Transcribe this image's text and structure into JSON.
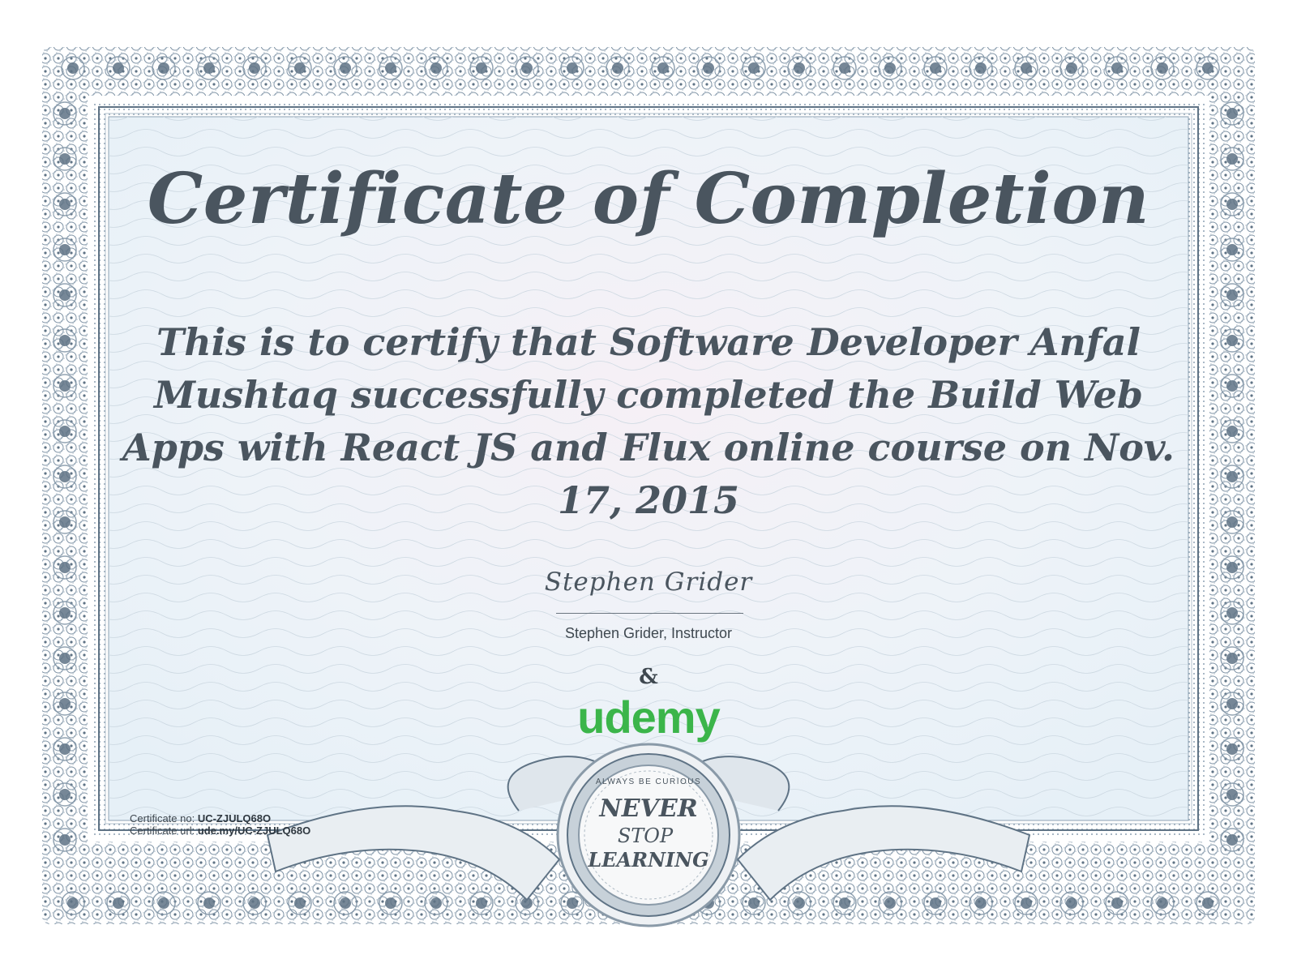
{
  "certificate": {
    "title": "Certificate of Completion",
    "statement": "This is to certify that Software Developer Anfal Mushtaq successfully completed the Build Web Apps with React JS and Flux online course on Nov. 17, 2015",
    "signature_name": "Stephen Grider",
    "signer_caption": "Stephen Grider, Instructor",
    "ampersand": "&",
    "brand_logo_text": "udemy",
    "certificate_no_label": "Certificate no:",
    "certificate_no": "UC-ZJULQ68O",
    "certificate_url_label": "Certificate url:",
    "certificate_url": "ude.my/UC-ZJULQ68O"
  },
  "seal": {
    "top_text": "ALWAYS BE CURIOUS",
    "line1": "NEVER",
    "line2": "STOP",
    "line3": "LEARNING"
  },
  "colors": {
    "text": "#4a555f",
    "border": "#5f7385",
    "brand_green": "#3bb54a"
  }
}
